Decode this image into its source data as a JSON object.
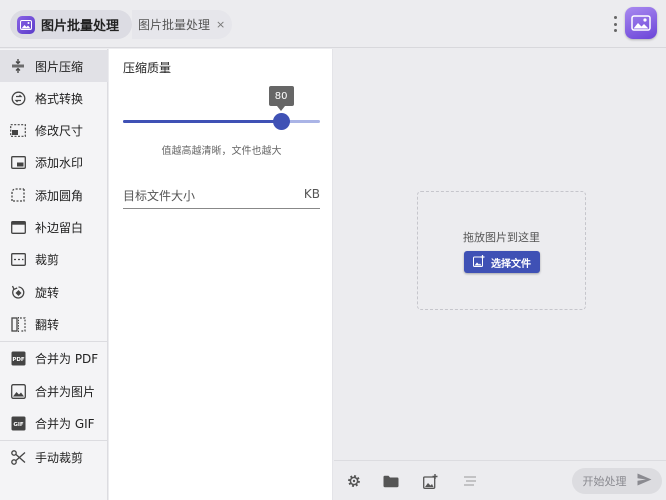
{
  "titlebar": {
    "tab_active_label": "图片批量处理",
    "tab_second_label": "图片批量处理",
    "tab_close": "×"
  },
  "sidebar": {
    "items": [
      {
        "label": "图片压缩",
        "icon": "compress-icon",
        "active": true
      },
      {
        "label": "格式转换",
        "icon": "convert-icon"
      },
      {
        "label": "修改尺寸",
        "icon": "resize-icon"
      },
      {
        "label": "添加水印",
        "icon": "watermark-icon"
      },
      {
        "label": "添加圆角",
        "icon": "rounded-corner-icon"
      },
      {
        "label": "补边留白",
        "icon": "padding-icon"
      },
      {
        "label": "裁剪",
        "icon": "crop-icon"
      },
      {
        "label": "旋转",
        "icon": "rotate-icon"
      },
      {
        "label": "翻转",
        "icon": "flip-icon"
      },
      {
        "label": "合并为 PDF",
        "icon": "pdf-icon"
      },
      {
        "label": "合并为图片",
        "icon": "image-icon"
      },
      {
        "label": "合并为 GIF",
        "icon": "gif-icon"
      },
      {
        "label": "手动裁剪",
        "icon": "scissors-icon"
      }
    ]
  },
  "settings": {
    "quality_title": "压缩质量",
    "quality_value": 80,
    "quality_value_text": "80",
    "quality_max": 100,
    "quality_hint": "值越高越清晰，文件也越大",
    "target_size_placeholder": "目标文件大小",
    "target_size_unit": "KB"
  },
  "dropzone": {
    "text": "拖放图片到这里",
    "button_label": "选择文件"
  },
  "toolbar": {
    "start_label": "开始处理"
  },
  "colors": {
    "accent": "#3f51b5",
    "accent_light": "#aab4e6",
    "brand": "#7b55e0"
  }
}
